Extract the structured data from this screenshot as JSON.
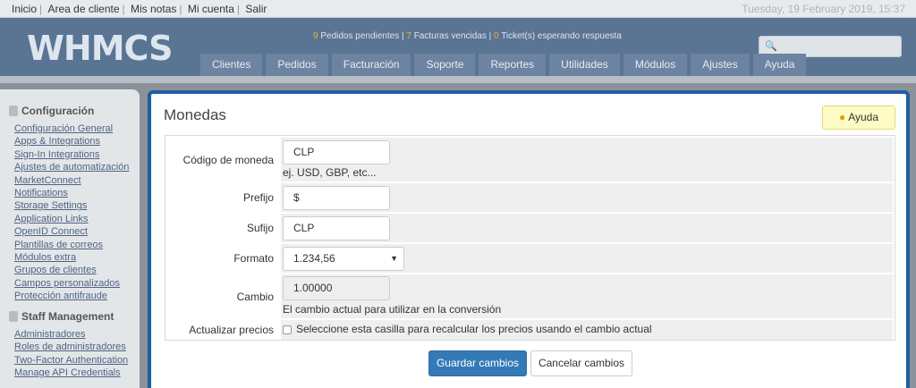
{
  "topbar": {
    "links": [
      "Inicio",
      "Area de cliente",
      "Mis notas",
      "Mi cuenta",
      "Salir"
    ],
    "datetime": "Tuesday, 19 February 2019, 15:37"
  },
  "header": {
    "logo": "WHMCS",
    "stats": {
      "pedidos_num": "9",
      "pedidos_label": "Pedidos pendientes",
      "facturas_num": "7",
      "facturas_label": "Facturas vencidas",
      "tickets_num": "0",
      "tickets_label": "Ticket(s) esperando respuesta"
    },
    "nav": [
      "Clientes",
      "Pedidos",
      "Facturación",
      "Soporte",
      "Reportes",
      "Utilidades",
      "Módulos",
      "Ajustes",
      "Ayuda"
    ]
  },
  "sidebar": {
    "config_title": "Configuración",
    "config_links": [
      "Configuración General",
      "Apps & Integrations",
      "Sign-In Integrations",
      "Ajustes de automatización",
      "MarketConnect",
      "Notifications",
      "Storage Settings",
      "Application Links",
      "OpenID Connect",
      "Plantillas de correos",
      "Módulos extra",
      "Grupos de clientes",
      "Campos personalizados",
      "Protección antifraude"
    ],
    "staff_title": "Staff Management",
    "staff_links": [
      "Administradores",
      "Roles de administradores",
      "Two-Factor Authentication",
      "Manage API Credentials"
    ]
  },
  "page": {
    "title": "Monedas",
    "help_label": "Ayuda"
  },
  "form": {
    "code_label": "Código de moneda",
    "code_value": "CLP",
    "code_help": "ej. USD, GBP, etc...",
    "prefix_label": "Prefijo",
    "prefix_value": "$",
    "suffix_label": "Sufijo",
    "suffix_value": "CLP",
    "format_label": "Formato",
    "format_value": "1.234,56",
    "rate_label": "Cambio",
    "rate_value": "1.00000",
    "rate_help": "El cambio actual para utilizar en la conversión",
    "update_label": "Actualizar precios",
    "update_checkbox_label": "Seleccione esta casilla para recalcular los precios usando el cambio actual",
    "update_checked": false
  },
  "actions": {
    "save": "Guardar cambios",
    "cancel": "Cancelar cambios"
  },
  "colors": {
    "accent": "#337ab7",
    "header": "#5a7494",
    "panel_border": "#1f5fa0"
  }
}
